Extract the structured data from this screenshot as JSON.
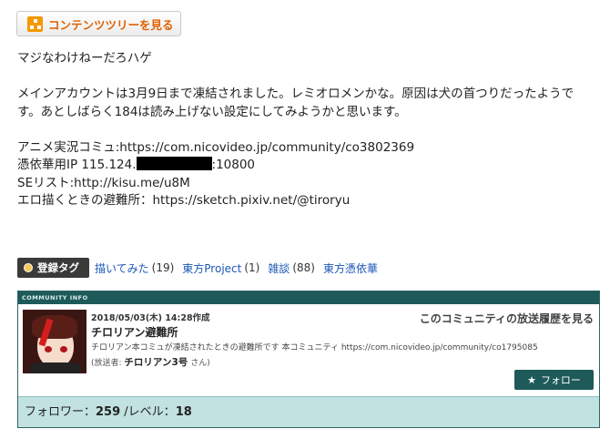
{
  "content_tree_button": {
    "label": "コンテンツツリーを見る",
    "icon": "tree-icon"
  },
  "description": {
    "line1": "マジなわけねーだろハゲ",
    "para2_line1": "メインアカウントは3月9日まで凍結されました。レミオロメンかな。原因は犬の首つりだったようで",
    "para2_line2": "す。あとしばらく184は読み上げない設定にしてみようかと思います。",
    "community_url_line": "アニメ実況コミュ:https://com.nicovideo.jp/community/co3802369",
    "ip_prefix": "憑依華用IP 115.124.",
    "ip_suffix": ":10800",
    "se_list": "SEリスト:http://kisu.me/u8M",
    "pixiv_line": "エロ描くときの避難所：https://sketch.pixiv.net/@tiroryu"
  },
  "tags": {
    "badge_label": "登録タグ",
    "items": [
      {
        "name": "描いてみた",
        "count": "(19)"
      },
      {
        "name": "東方Project",
        "count": "(1)"
      },
      {
        "name": "雑談",
        "count": "(88)"
      },
      {
        "name": "東方憑依華",
        "count": ""
      }
    ]
  },
  "community": {
    "header": "COMMUNITY INFO",
    "created": "2018/05/03(木) 14:28作成",
    "name": "チロリアン避難所",
    "description": "チロリアン本コミュが凍結されたときの避難所です 本コミュニティ https://com.nicovideo.jp/community/co1795085",
    "owner_prefix": "(放送者:",
    "owner_name": "チロリアン3号",
    "owner_suffix": "さん)",
    "history_link": "このコミュニティの放送履歴を見る",
    "follow_label": "フォロー",
    "follow_icon": "star-icon",
    "followers_label": "フォロワー：",
    "followers": "259",
    "level_label": "/レベル：",
    "level": "18"
  },
  "colors": {
    "accent_orange": "#f39800",
    "link_blue": "#1b58b8",
    "community_teal": "#1e5a5a",
    "footer_bg": "#c2e2e2"
  }
}
